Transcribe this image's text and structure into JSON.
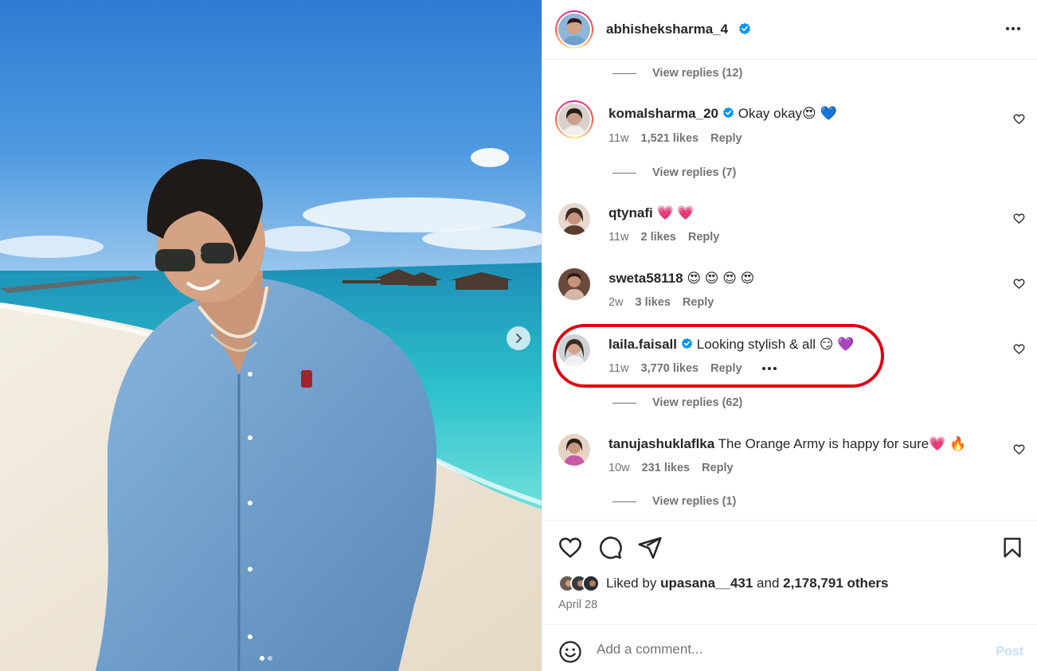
{
  "colors": {
    "accent": "#0095f6",
    "post_disabled": "#c0dffd",
    "highlight": "#e00012",
    "secondary_text": "#737373",
    "heart_red": "#ff2d55"
  },
  "post": {
    "author": "abhisheksharma_4",
    "verified": true,
    "more_icon": "more-horizontal-icon",
    "carousel": {
      "current": 1,
      "total": 2,
      "next_icon": "chevron-right-icon"
    }
  },
  "comments": [
    {
      "type": "replies",
      "label": "View replies (12)"
    },
    {
      "type": "comment",
      "user": "komalsharma_20",
      "verified": true,
      "text": "Okay okay😍 💙",
      "age": "11w",
      "likes": "1,521 likes",
      "reply": "Reply",
      "story_ring": true
    },
    {
      "type": "replies",
      "label": "View replies (7)"
    },
    {
      "type": "comment",
      "user": "qtynafi",
      "verified": false,
      "text": "💗 💗",
      "age": "11w",
      "likes": "2 likes",
      "reply": "Reply"
    },
    {
      "type": "comment",
      "user": "sweta58118",
      "verified": false,
      "text": "😍 😍 😍 😍",
      "age": "2w",
      "likes": "3 likes",
      "reply": "Reply"
    },
    {
      "type": "comment",
      "user": "laila.faisall",
      "verified": true,
      "text": "Looking stylish & all 😏 💜",
      "age": "11w",
      "likes": "3,770 likes",
      "reply": "Reply",
      "highlighted": true,
      "options_icon": "more-horizontal-icon"
    },
    {
      "type": "replies",
      "label": "View replies (62)"
    },
    {
      "type": "comment",
      "user": "tanujashuklaflka",
      "verified": false,
      "text": "The Orange Army is happy for sure💗 🔥",
      "age": "10w",
      "likes": "231 likes",
      "reply": "Reply"
    },
    {
      "type": "replies",
      "label": "View replies (1)"
    }
  ],
  "actions": {
    "icons": [
      "heart-icon",
      "comment-icon",
      "share-icon",
      "bookmark-icon"
    ],
    "liked_by_prefix": "Liked by",
    "liked_by_user": "upasana__431",
    "liked_by_and": "and",
    "liked_by_others": "2,178,791 others",
    "date": "April 28"
  },
  "composer": {
    "placeholder": "Add a comment...",
    "post_label": "Post",
    "emoji_icon": "smiley-icon"
  }
}
